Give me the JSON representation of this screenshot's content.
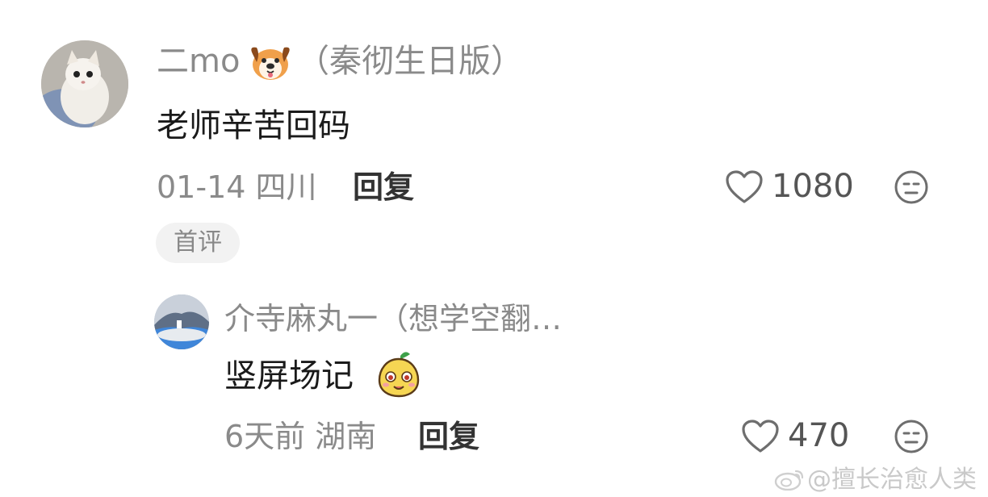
{
  "comment": {
    "username": "二mo",
    "username_suffix": "（秦彻生日版）",
    "username_emoji": "dog-face-icon",
    "text": "老师辛苦回码",
    "meta": "01-14 四川",
    "reply_label": "回复",
    "like_count": "1080",
    "badge": "首评"
  },
  "reply": {
    "username": "介寺麻丸一（想学空翻…",
    "text": "竖屏场记",
    "text_emoji": "fruit-face-icon",
    "meta": "6天前 湖南",
    "reply_label": "回复",
    "like_count": "470"
  },
  "watermark": {
    "text": "@擅长治愈人类",
    "icon": "weibo-icon"
  },
  "colors": {
    "background": "#ffffff",
    "primary_text": "#1a1a1a",
    "secondary_text": "#8a8a8a",
    "badge_bg": "#f2f2f2"
  }
}
